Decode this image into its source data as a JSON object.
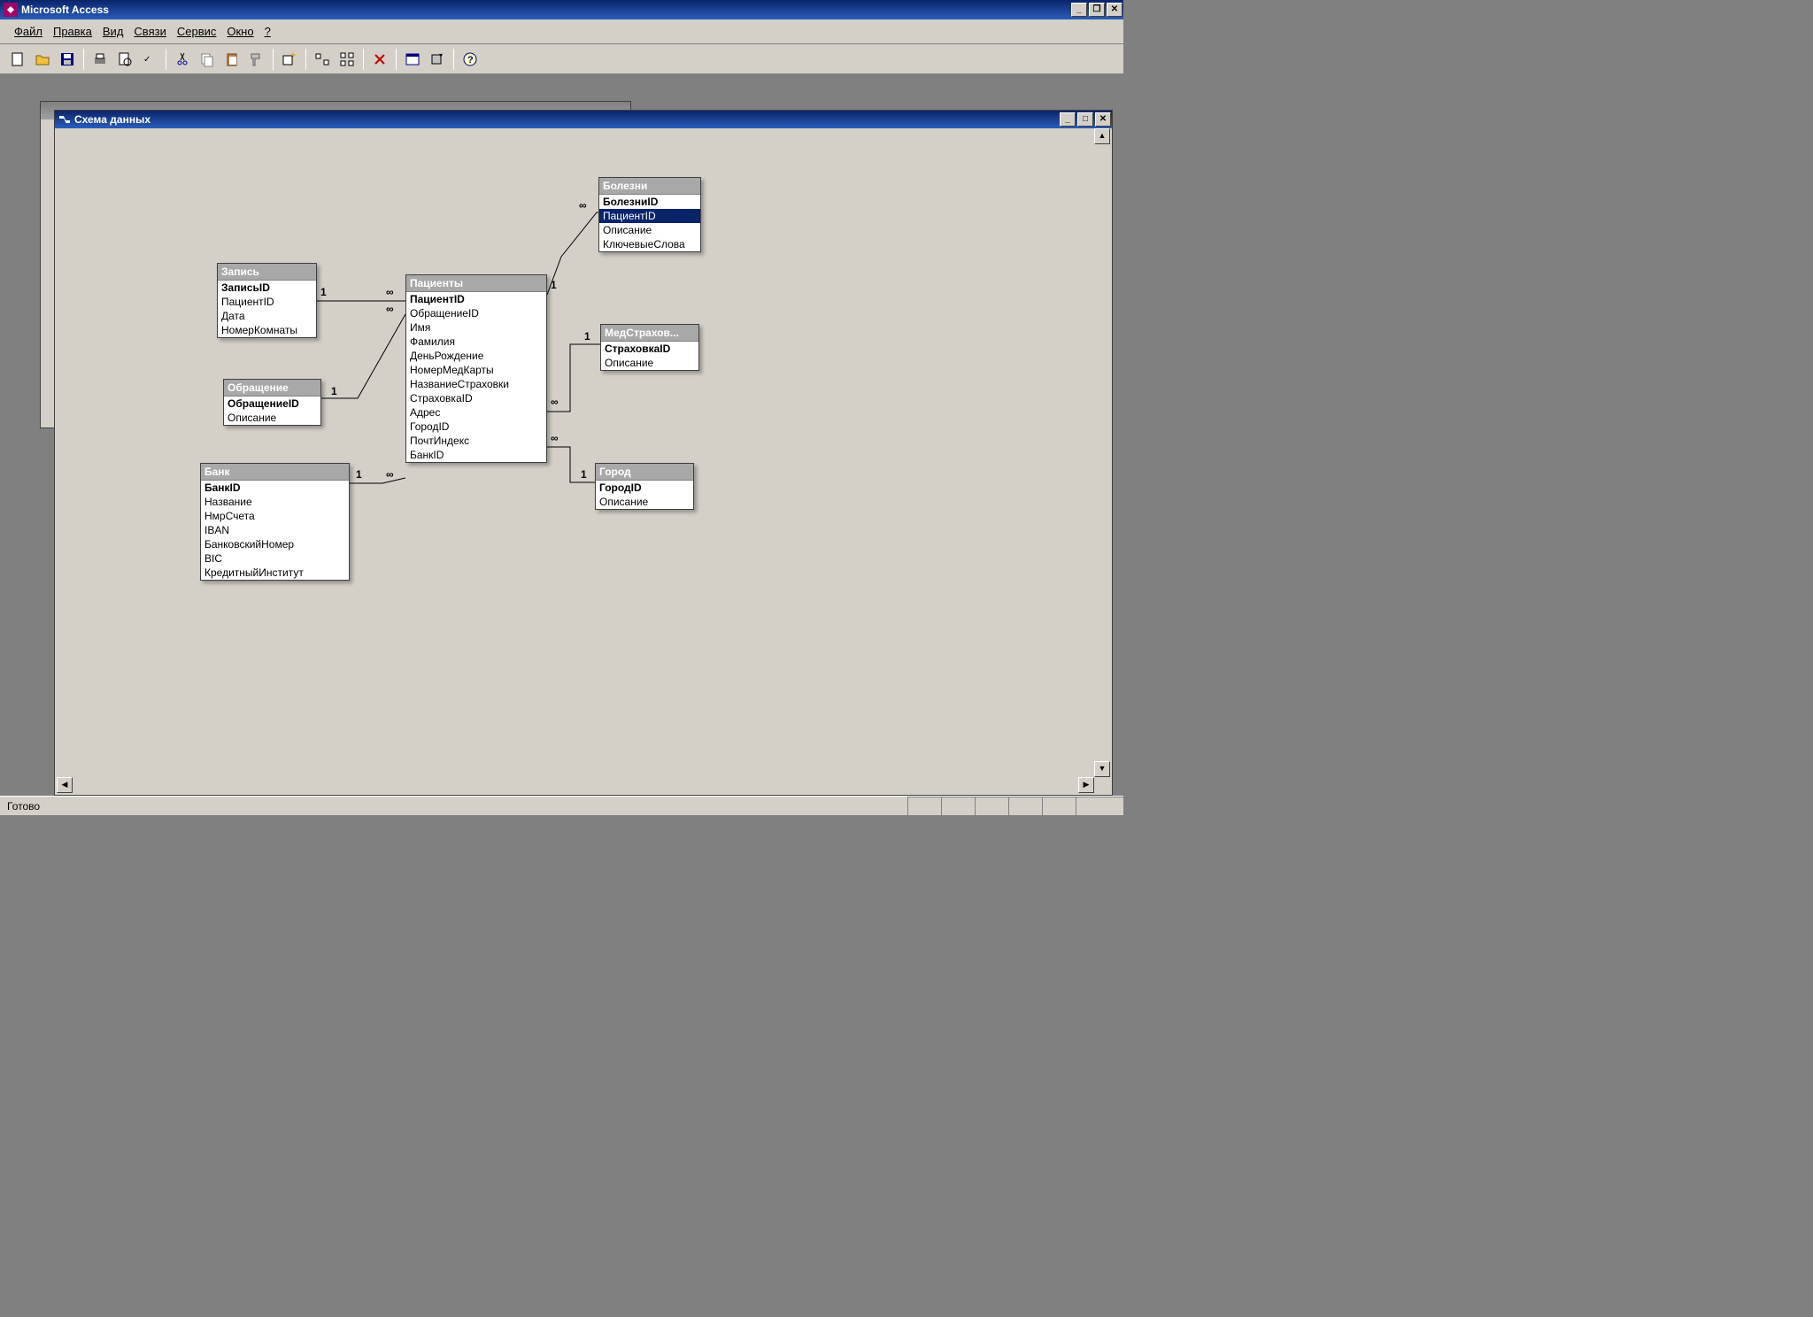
{
  "app": {
    "title": "Microsoft Access"
  },
  "menu": {
    "file": "Файл",
    "edit": "Правка",
    "view": "Вид",
    "relations": "Связи",
    "service": "Сервис",
    "window": "Окно",
    "help": "?"
  },
  "child": {
    "title": "Схема данных"
  },
  "tables": {
    "zapis": {
      "title": "Запись",
      "fields": [
        "ЗаписьID",
        "ПациентID",
        "Дата",
        "НомерКомнаты"
      ]
    },
    "obr": {
      "title": "Обращение",
      "fields": [
        "ОбращениеID",
        "Описание"
      ]
    },
    "bank": {
      "title": "Банк",
      "fields": [
        "БанкID",
        "Название",
        "НмрСчета",
        "IBAN",
        "БанковскийНомер",
        "BIC",
        "КредитныйИнститут"
      ]
    },
    "pac": {
      "title": "Пациенты",
      "fields": [
        "ПациентID",
        "ОбращениеID",
        "Имя",
        "Фамилия",
        "ДеньРождение",
        "НомерМедКарты",
        "НазваниеСтраховки",
        "СтраховкаID",
        "Адрес",
        "ГородID",
        "ПочтИндекс",
        "БанкID"
      ]
    },
    "bolezni": {
      "title": "Болезни",
      "fields": [
        "БолезниID",
        "ПациентID",
        "Описание",
        "КлючевыеСлова"
      ]
    },
    "med": {
      "title": "МедСтрахов...",
      "fields": [
        "СтраховкаID",
        "Описание"
      ]
    },
    "gorod": {
      "title": "Город",
      "fields": [
        "ГородID",
        "Описание"
      ]
    }
  },
  "cardinality": {
    "one": "1",
    "many": "∞"
  },
  "status": {
    "text": "Готово"
  }
}
